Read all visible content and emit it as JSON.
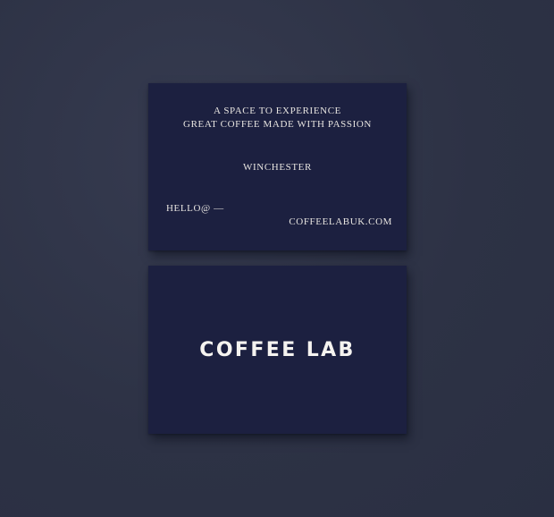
{
  "back_card": {
    "tagline_line_1": "A SPACE TO EXPERIENCE",
    "tagline_line_2": "GREAT COFFEE MADE WITH PASSION",
    "city": "WINCHESTER",
    "email_prefix": "HELLO@ —",
    "website": "COFFEELABUK.COM"
  },
  "front_card": {
    "brand_name": "COFFEE LAB"
  },
  "colors": {
    "background": "#2d3245",
    "card": "#1c2040",
    "text": "#e7e4e0"
  }
}
